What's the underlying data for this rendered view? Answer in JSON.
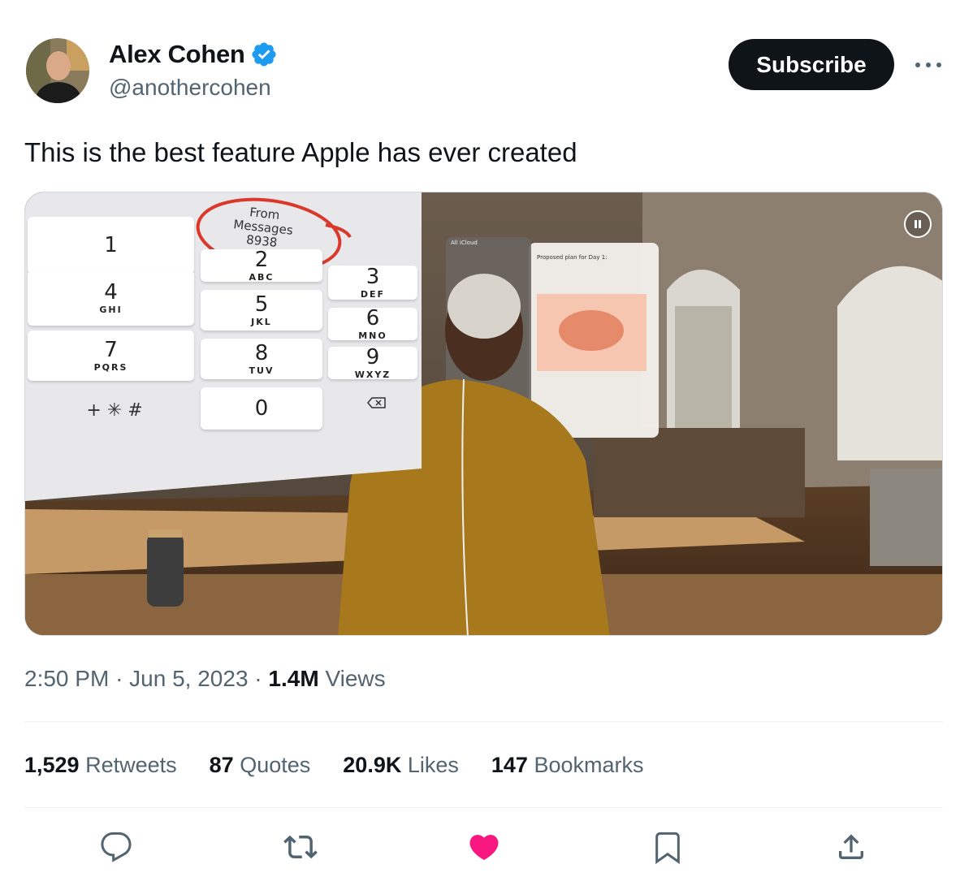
{
  "author": {
    "name": "Alex Cohen",
    "handle": "@anothercohen",
    "verified": true
  },
  "header": {
    "subscribe_label": "Subscribe",
    "more_icon": "ellipsis-icon"
  },
  "tweet": {
    "text": "This is the best feature Apple has ever created"
  },
  "media": {
    "type": "video",
    "overlay_label_1": "From Messages",
    "overlay_label_2": "8938",
    "icloud_title": "All iCloud",
    "notes_title": "Proposed plan for Day 1:",
    "keypad": [
      {
        "digit": "1",
        "letters": ""
      },
      {
        "digit": "2",
        "letters": "ABC"
      },
      {
        "digit": "3",
        "letters": "DEF"
      },
      {
        "digit": "4",
        "letters": "GHI"
      },
      {
        "digit": "5",
        "letters": "JKL"
      },
      {
        "digit": "6",
        "letters": "MNO"
      },
      {
        "digit": "7",
        "letters": "PQRS"
      },
      {
        "digit": "8",
        "letters": "TUV"
      },
      {
        "digit": "9",
        "letters": "WXYZ"
      },
      {
        "digit": "+ ✳ #",
        "letters": ""
      },
      {
        "digit": "0",
        "letters": ""
      }
    ],
    "pause_icon": "pause-icon"
  },
  "meta": {
    "time": "2:50 PM",
    "sep1": "·",
    "date": "Jun 5, 2023",
    "sep2": "·",
    "views_count": "1.4M",
    "views_label": "Views"
  },
  "stats": {
    "retweets_count": "1,529",
    "retweets_label": "Retweets",
    "quotes_count": "87",
    "quotes_label": "Quotes",
    "likes_count": "20.9K",
    "likes_label": "Likes",
    "bookmarks_count": "147",
    "bookmarks_label": "Bookmarks"
  },
  "colors": {
    "text": "#0f1419",
    "secondary": "#536471",
    "like": "#f91880",
    "verified": "#1d9bf0"
  },
  "actions": [
    "reply-icon",
    "retweet-icon",
    "like-icon",
    "bookmark-icon",
    "share-icon"
  ]
}
